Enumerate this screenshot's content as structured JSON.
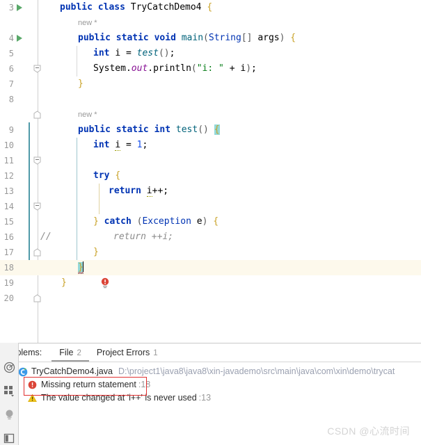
{
  "editor": {
    "lines": [
      {
        "num": "3",
        "run": true,
        "fold": null,
        "indent": 0
      },
      {
        "num": "4",
        "run": true,
        "fold": "open",
        "indent": 0
      },
      {
        "num": "5",
        "run": false,
        "fold": null,
        "indent": 1
      },
      {
        "num": "6",
        "run": false,
        "fold": null,
        "indent": 1
      },
      {
        "num": "7",
        "run": false,
        "fold": "close",
        "indent": 0
      },
      {
        "num": "8",
        "run": false,
        "fold": null,
        "indent": 0
      },
      {
        "num": "9",
        "run": false,
        "fold": "open",
        "indent": 0
      },
      {
        "num": "10",
        "run": false,
        "fold": null,
        "indent": 1
      },
      {
        "num": "11",
        "run": false,
        "fold": null,
        "indent": 1
      },
      {
        "num": "12",
        "run": false,
        "fold": "open",
        "indent": 1
      },
      {
        "num": "13",
        "run": false,
        "fold": null,
        "indent": 2
      },
      {
        "num": "14",
        "run": false,
        "fold": null,
        "indent": 2
      },
      {
        "num": "15",
        "run": false,
        "fold": "close",
        "indent": 1
      },
      {
        "num": "16",
        "run": false,
        "fold": null,
        "indent": 2
      },
      {
        "num": "17",
        "run": false,
        "fold": null,
        "indent": 1
      },
      {
        "num": "18",
        "run": false,
        "fold": "close",
        "indent": 0
      },
      {
        "num": "19",
        "run": false,
        "fold": null,
        "indent": 0
      },
      {
        "num": "20",
        "run": false,
        "fold": null,
        "indent": 0
      }
    ],
    "inlay_hint": "new *",
    "line_margin_comment": "//",
    "code": {
      "l3_public": "public",
      "l3_class": "class",
      "l3_name": "TryCatchDemo4",
      "l3_brace": "{",
      "l4_text": "public static void main(String[] args) {",
      "l5_text": "int i = test();",
      "l6_text": "System.out.println(\"i: \" + i);",
      "l7_text": "}",
      "l9_text": "public static int test() {",
      "l10_text": "int i = 1;",
      "l12_text": "try {",
      "l13_text": "return i++;",
      "l15_text": "} catch (Exception e) {",
      "l16_text": "return ++i;",
      "l17_text": "}",
      "l18_text": "}",
      "l19_text": "}"
    }
  },
  "panel": {
    "title": "Problems:",
    "tabs": [
      {
        "label": "File",
        "count": "2",
        "selected": true
      },
      {
        "label": "Project Errors",
        "count": "1",
        "selected": false
      }
    ],
    "file_row": {
      "name": "TryCatchDemo4.java",
      "path": "D:\\project1\\java8\\java8\\xin-javademo\\src\\main\\java\\com\\xin\\demo\\trycat"
    },
    "problems": [
      {
        "severity": "error",
        "message": "Missing return statement",
        "line": ":18"
      },
      {
        "severity": "warning",
        "message": "The value changed at 'i++' is never used",
        "line": ":13"
      }
    ]
  },
  "sidebar": {
    "items": [
      {
        "icon": "radar-icon"
      },
      {
        "icon": "grid-dropdown-icon"
      },
      {
        "icon": "lightbulb-icon"
      },
      {
        "icon": "panel-layout-icon"
      }
    ]
  },
  "watermark": {
    "text": "CSDN @心流时间"
  },
  "colors": {
    "keyword": "#0033b3",
    "string": "#067d17",
    "number": "#1750eb",
    "static_field": "#871094",
    "brace": "#c9a227",
    "comment": "#8c8c8c",
    "error": "#e03030",
    "warning": "#e8b52a",
    "run_arrow": "#59a869",
    "current_line_bg": "#fdf9ec",
    "bracket_highlight": "#93d9d9"
  }
}
